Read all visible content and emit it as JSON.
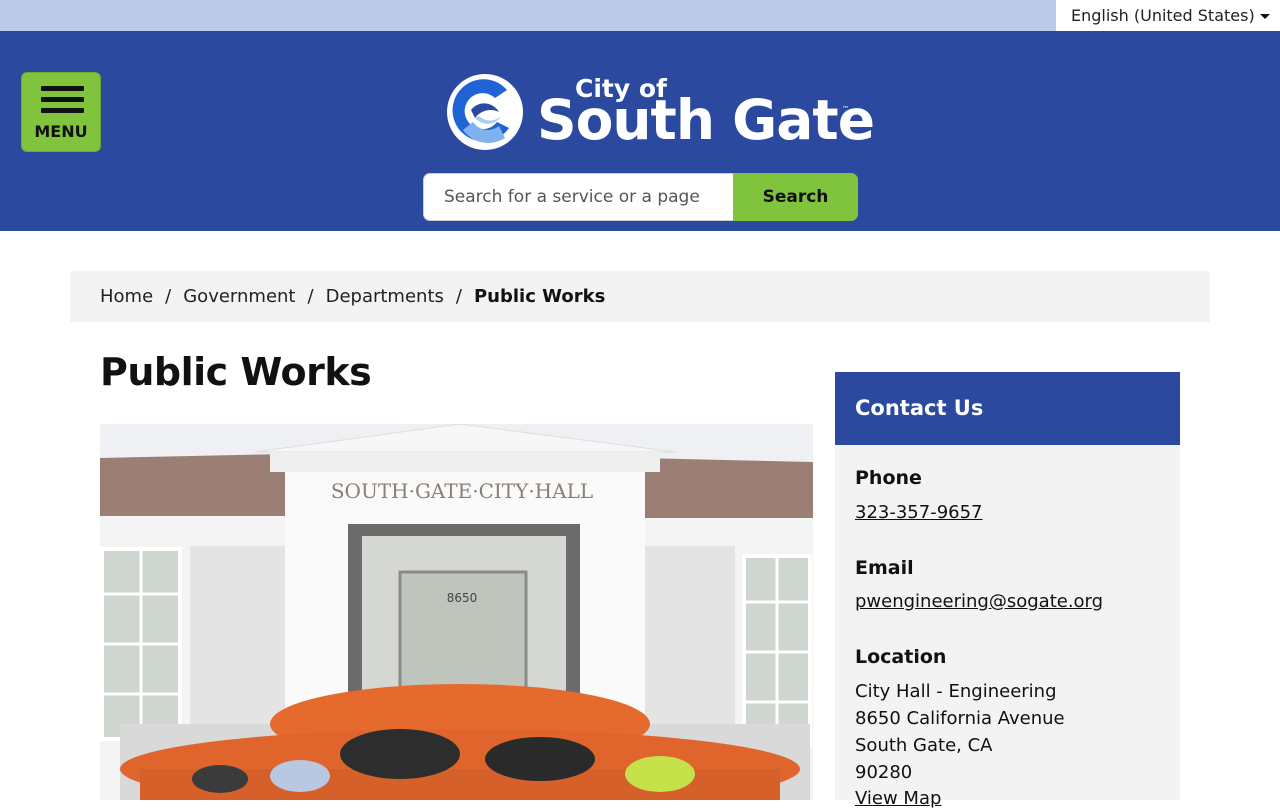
{
  "language": {
    "selected": "English (United States)"
  },
  "menu": {
    "label": "MENU"
  },
  "logo": {
    "city_of": "City of",
    "name": "South Gate",
    "tm": "™"
  },
  "search": {
    "placeholder": "Search for a service or a page",
    "button": "Search"
  },
  "breadcrumb": {
    "items": [
      "Home",
      "Government",
      "Departments"
    ],
    "separator": "/",
    "current": "Public Works"
  },
  "page": {
    "title": "Public Works"
  },
  "hero": {
    "building_sign": "SOUTH·GATE·CITY·HALL",
    "address_number": "8650"
  },
  "contact": {
    "heading": "Contact Us",
    "phone_label": "Phone",
    "phone": "323-357-9657",
    "email_label": "Email",
    "email": "pwengineering@sogate.org",
    "location_label": "Location",
    "location_lines": [
      "City Hall - Engineering",
      "8650 California Avenue",
      "South Gate, CA",
      "90280"
    ],
    "map_link": "View Map"
  },
  "colors": {
    "header": "#2b4a9f",
    "accent": "#80c33d",
    "topbar": "#bccbe9",
    "panel": "#f3f3f3"
  }
}
